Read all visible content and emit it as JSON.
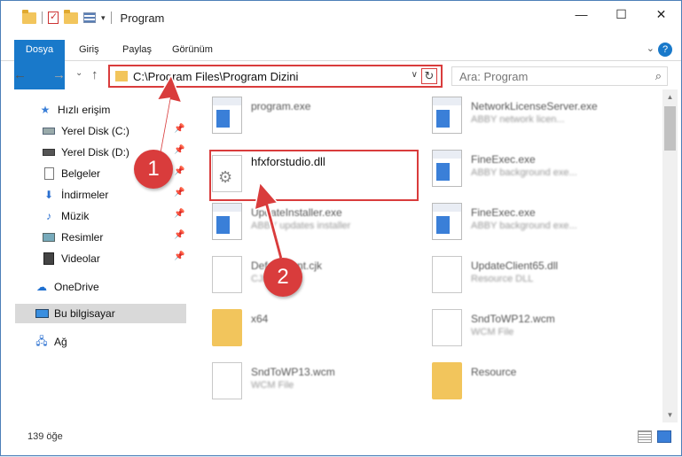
{
  "titlebar": {
    "title": "Program",
    "minimize": "—",
    "maximize": "☐",
    "close": "✕"
  },
  "ribbon": {
    "tabs": [
      "Dosya",
      "Giriş",
      "Paylaş",
      "Görünüm"
    ],
    "help": "?"
  },
  "nav": {
    "back": "←",
    "forward": "→",
    "recent": "⌄",
    "up": "↑",
    "address": "C:\\Program Files\\Program Dizini",
    "refresh": "↻",
    "search_placeholder": "Ara: Program",
    "search_icon": "magnifier-icon"
  },
  "sidebar": {
    "items": [
      {
        "label": "Hızlı erişim",
        "icon": "star-icon"
      },
      {
        "label": "Yerel Disk (C:)",
        "icon": "drive-icon"
      },
      {
        "label": "Yerel Disk (D:)",
        "icon": "drive-icon"
      },
      {
        "label": "Belgeler",
        "icon": "documents-icon"
      },
      {
        "label": "İndirmeler",
        "icon": "download-icon"
      },
      {
        "label": "Müzik",
        "icon": "music-icon"
      },
      {
        "label": "Resimler",
        "icon": "pictures-icon"
      },
      {
        "label": "Videolar",
        "icon": "video-icon"
      },
      {
        "label": "OneDrive",
        "icon": "cloud-icon"
      },
      {
        "label": "Bu bilgisayar",
        "icon": "computer-icon"
      },
      {
        "label": "Ağ",
        "icon": "network-icon"
      }
    ]
  },
  "files": [
    {
      "name": "program.exe",
      "sub": ""
    },
    {
      "name": "NetworkLicenseServer.exe",
      "sub": "ABBY network licen..."
    },
    {
      "name": "hfxforstudio.dll",
      "sub": ""
    },
    {
      "name": "FineExec.exe",
      "sub": "ABBY background exe..."
    },
    {
      "name": "UpdateInstaller.exe",
      "sub": "ABBY updates installer"
    },
    {
      "name": "FineExec.exe",
      "sub": "ABBY background exe..."
    },
    {
      "name": "DefaultFont.cjk",
      "sub": "CJK File"
    },
    {
      "name": "UpdateClient65.dll",
      "sub": "Resource DLL"
    },
    {
      "name": "x64",
      "sub": ""
    },
    {
      "name": "SndToWP12.wcm",
      "sub": "WCM File"
    },
    {
      "name": "SndToWP13.wcm",
      "sub": "WCM File"
    },
    {
      "name": "Resource",
      "sub": ""
    }
  ],
  "status": {
    "count": "139 öğe"
  },
  "callouts": {
    "first": "1",
    "second": "2",
    "color": "#d93c3c"
  }
}
